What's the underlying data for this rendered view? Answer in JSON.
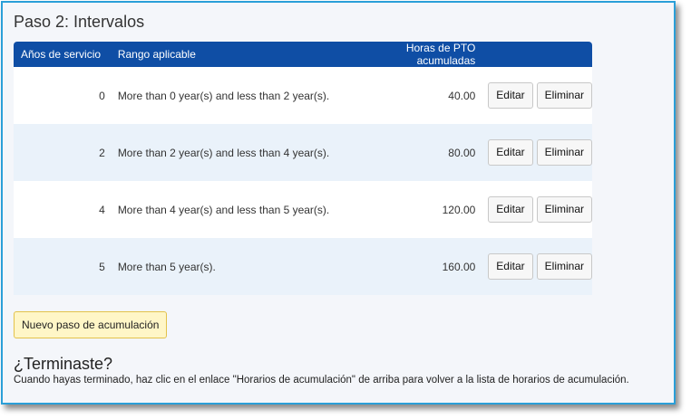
{
  "step_title": "Paso 2: Intervalos",
  "table": {
    "headers": {
      "years": "Años de servicio",
      "range": "Rango aplicable",
      "hours": "Horas de PTO acumuladas",
      "actions": ""
    },
    "rows": [
      {
        "years": "0",
        "range": "More than 0 year(s) and less than 2 year(s).",
        "hours": "40.00",
        "edit": "Editar",
        "delete": "Eliminar"
      },
      {
        "years": "2",
        "range": "More than 2 year(s) and less than 4 year(s).",
        "hours": "80.00",
        "edit": "Editar",
        "delete": "Eliminar"
      },
      {
        "years": "4",
        "range": "More than 4 year(s) and less than 5 year(s).",
        "hours": "120.00",
        "edit": "Editar",
        "delete": "Eliminar"
      },
      {
        "years": "5",
        "range": "More than 5 year(s).",
        "hours": "160.00",
        "edit": "Editar",
        "delete": "Eliminar"
      }
    ]
  },
  "new_step_label": "Nuevo paso de acumulación",
  "done": {
    "title": "¿Terminaste?",
    "text": "Cuando hayas terminado, haz clic en el enlace \"Horarios de acumulación\" de arriba para volver a la lista de horarios de acumulación."
  },
  "colors": {
    "header_bg": "#0f4ea5",
    "frame_border": "#2a9fd8",
    "row_alt_bg": "#eaf2fa",
    "new_step_bg": "#fff6c7"
  }
}
